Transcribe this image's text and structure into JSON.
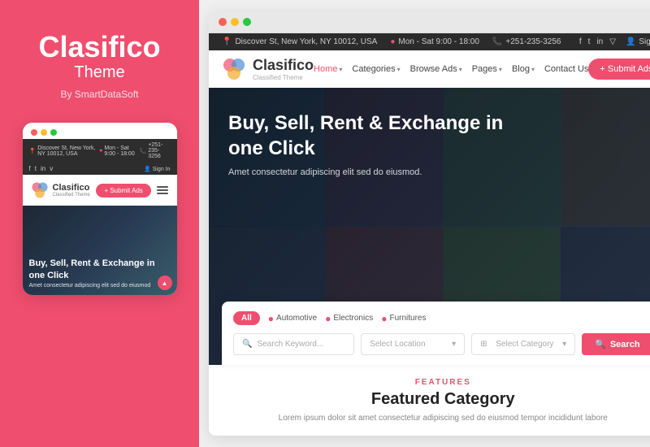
{
  "left_panel": {
    "brand_name": "Clasifico",
    "brand_sub": "Theme",
    "brand_by": "By SmartDataSoft"
  },
  "mobile_mockup": {
    "address": "Discover St, New York, NY 10012, USA",
    "hours": "Mon - Sat 9:00 - 18:00",
    "phone": "+251-235-3256",
    "sign_in": "Sign In",
    "logo_name": "Clasifico",
    "logo_sub": "Classified Theme",
    "submit_btn": "+ Submit Ads",
    "hero_title": "Buy, Sell, Rent & Exchange in one Click",
    "hero_sub": "Amet consectetur adipiscing elit sed do eiusmod"
  },
  "browser": {
    "info_bar": {
      "address": "Discover St, New York, NY 10012, USA",
      "hours": "Mon - Sat 9:00 - 18:00",
      "phone": "+251-235-3256",
      "sign_in": "Sign In",
      "social": [
        "f",
        "t",
        "in",
        "▽"
      ]
    },
    "nav": {
      "logo_name": "Clasifico",
      "logo_sub": "Classified Theme",
      "links": [
        {
          "label": "Home",
          "has_chevron": true
        },
        {
          "label": "Categories",
          "has_chevron": true
        },
        {
          "label": "Browse Ads",
          "has_chevron": true
        },
        {
          "label": "Pages",
          "has_chevron": true
        },
        {
          "label": "Blog",
          "has_chevron": true
        },
        {
          "label": "Contact Us",
          "has_chevron": false
        }
      ],
      "submit_btn": "+ Submit Ads"
    },
    "hero": {
      "title": "Buy, Sell, Rent & Exchange in one Click",
      "subtitle": "Amet consectetur adipiscing elit sed do eiusmod."
    },
    "search": {
      "tabs": [
        "All",
        "Automotive",
        "Electronics",
        "Furnitures"
      ],
      "keyword_placeholder": "Search Keyword...",
      "location_placeholder": "Select Location",
      "category_placeholder": "Select Category",
      "search_btn": "Search"
    },
    "features": {
      "label": "FEATURES",
      "title": "Featured Category",
      "desc": "Lorem ipsum dolor sit amet consectetur adipiscing sed do eiusmod tempor incididunt labore"
    }
  }
}
